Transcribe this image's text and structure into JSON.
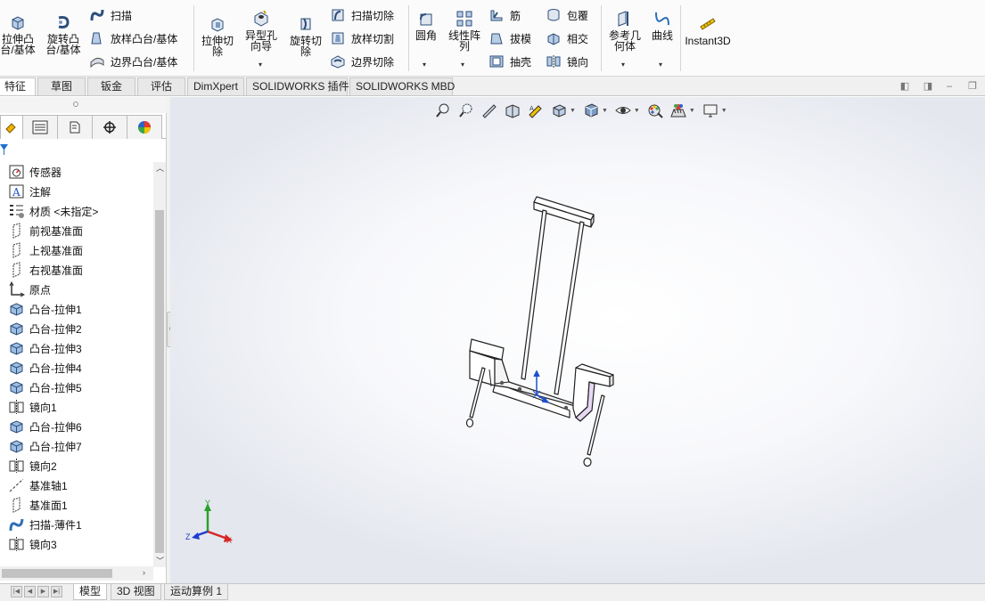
{
  "ribbon": {
    "extrude_boss": "拉伸凸\n台/基体",
    "revolve_boss": "旋转凸\n台/基体",
    "sweep": "扫描",
    "loft_boss": "放样凸台/基体",
    "boundary_boss": "边界凸台/基体",
    "extrude_cut": "拉伸切\n除",
    "hole_wizard": "异型孔\n向导",
    "revolve_cut": "旋转切\n除",
    "swept_cut": "扫描切除",
    "lofted_cut": "放样切割",
    "boundary_cut": "边界切除",
    "fillet": "圆角",
    "linear_pattern": "线性阵\n列",
    "rib": "筋",
    "draft": "拔模",
    "shell": "抽壳",
    "wrap": "包覆",
    "intersect": "相交",
    "mirror": "镜向",
    "reference_geometry": "参考几\n何体",
    "curves": "曲线",
    "instant3d": "Instant3D"
  },
  "tabs": [
    "特征",
    "草图",
    "钣金",
    "评估",
    "DimXpert",
    "SOLIDWORKS 插件",
    "SOLIDWORKS MBD"
  ],
  "tree": {
    "items": [
      {
        "label": "传感器",
        "icon": "sensor-icon"
      },
      {
        "label": "注解",
        "icon": "annotation-icon"
      },
      {
        "label": "材质 <未指定>",
        "icon": "material-icon"
      },
      {
        "label": "前视基准面",
        "icon": "plane-icon"
      },
      {
        "label": "上视基准面",
        "icon": "plane-icon"
      },
      {
        "label": "右视基准面",
        "icon": "plane-icon"
      },
      {
        "label": "原点",
        "icon": "origin-icon"
      },
      {
        "label": "凸台-拉伸1",
        "icon": "boss-extrude-icon"
      },
      {
        "label": "凸台-拉伸2",
        "icon": "boss-extrude-icon"
      },
      {
        "label": "凸台-拉伸3",
        "icon": "boss-extrude-icon"
      },
      {
        "label": "凸台-拉伸4",
        "icon": "boss-extrude-icon"
      },
      {
        "label": "凸台-拉伸5",
        "icon": "boss-extrude-icon"
      },
      {
        "label": "镜向1",
        "icon": "mirror-icon"
      },
      {
        "label": "凸台-拉伸6",
        "icon": "boss-extrude-icon"
      },
      {
        "label": "凸台-拉伸7",
        "icon": "boss-extrude-icon"
      },
      {
        "label": "镜向2",
        "icon": "mirror-icon"
      },
      {
        "label": "基准轴1",
        "icon": "axis-icon"
      },
      {
        "label": "基准面1",
        "icon": "plane-icon"
      },
      {
        "label": "扫描-薄件1",
        "icon": "sweep-thin-icon"
      },
      {
        "label": "镜向3",
        "icon": "mirror-icon"
      }
    ]
  },
  "triad": {
    "x": "X",
    "y": "Y",
    "z": "Z"
  },
  "bottom_tabs": [
    "模型",
    "3D 视图",
    "运动算例 1"
  ],
  "colors": {
    "accent_blue": "#1e6fd0",
    "part_face": "#ffffff",
    "part_edge": "#222222"
  }
}
